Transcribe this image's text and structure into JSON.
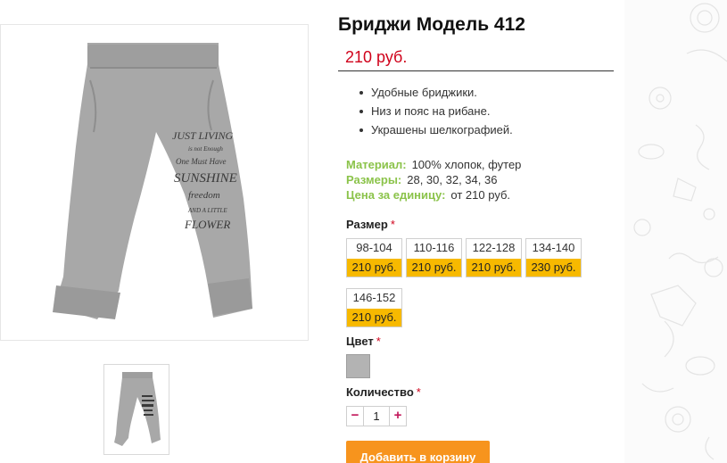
{
  "product": {
    "title": "Бриджи Модель 412",
    "price": "210 руб.",
    "features": [
      "Удобные бриджики.",
      "Низ и пояс на рибане.",
      "Украшены шелкографией."
    ],
    "specs": [
      {
        "key": "Материал:",
        "value": "100% хлопок, футер"
      },
      {
        "key": "Размеры:",
        "value": "28, 30, 32, 34, 36"
      },
      {
        "key": "Цена за единицу:",
        "value": "от 210 руб."
      }
    ],
    "print_text": [
      "JUST LIVING",
      "is not Enough",
      "One Must Have",
      "SUNSHINE",
      "freedom",
      "AND A LITTLE",
      "FLOWER"
    ]
  },
  "options": {
    "size_label": "Размер",
    "required_mark": "*",
    "sizes": [
      {
        "name": "98-104",
        "price": "210 руб."
      },
      {
        "name": "110-116",
        "price": "210 руб."
      },
      {
        "name": "122-128",
        "price": "210 руб."
      },
      {
        "name": "134-140",
        "price": "230 руб."
      },
      {
        "name": "146-152",
        "price": "210 руб."
      }
    ],
    "color_label": "Цвет",
    "color_swatch": "#b3b3b3",
    "quantity_label": "Количество",
    "quantity": {
      "minus": "−",
      "value": "1",
      "plus": "+"
    }
  },
  "actions": {
    "add_to_cart": "Добавить в корзину"
  },
  "colors": {
    "price": "#d0021b",
    "spec_key": "#8bc34a",
    "size_price_bg": "#f7b900",
    "cart_button": "#f7941d"
  }
}
